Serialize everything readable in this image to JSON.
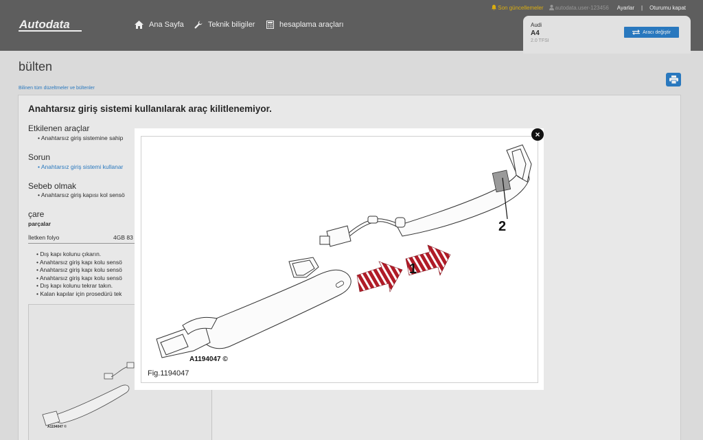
{
  "header": {
    "logo": "Autodata",
    "nav": [
      {
        "label": "Ana Sayfa",
        "icon": "home-icon"
      },
      {
        "label": "Teknik biligiler",
        "icon": "wrench-icon"
      },
      {
        "label": "hesaplama araçları",
        "icon": "calculator-icon"
      }
    ],
    "util": {
      "recent": "Son güncellemeler",
      "user": "autodata.user-123456",
      "settings": "Ayarlar",
      "separator": "|",
      "logout": "Oturumu kapat"
    },
    "vehicle": {
      "make": "Audi",
      "model": "A4",
      "engine": "2.0 TFSI",
      "change_button": "Aracı değiştir"
    }
  },
  "page": {
    "title": "bülten",
    "breadcrumb": "Bilinen tüm düzeltmeler ve bültenler"
  },
  "bulletin": {
    "title": "Anahtarsız giriş sistemi kullanılarak araç kilitlenemiyor.",
    "affected_heading": "Etkilenen araçlar",
    "affected_item": "• Anahtarsız giriş sistemine sahip",
    "problem_heading": "Sorun",
    "problem_item": "• Anahtarsız giriş sistemi kullanar",
    "cause_heading": "Sebeb olmak",
    "cause_item": "• Anahtarsız giriş kapısı kol sensö",
    "remedy_heading": "çare",
    "parts_heading": "parçalar",
    "parts": [
      {
        "name": "İletken folyo",
        "number": "4GB 83"
      }
    ],
    "steps": [
      "Dış kapı kolunu çıkarın.",
      "Anahtarsız giriş kapı kolu sensö",
      "Anahtarsız giriş kapı kolu sensö",
      "Anahtarsız giriş kapı kolu sensö",
      "Dış kapı kolunu tekrar takın.",
      "Kalan kapılar için prosedürü tek"
    ],
    "thumb_code": "A1194047 ©"
  },
  "modal": {
    "image_code": "A1194047 ©",
    "caption": "Fig.1194047",
    "callouts": [
      "1",
      "2"
    ],
    "close": "×"
  },
  "colors": {
    "header_bg": "#5b5b5b",
    "accent": "#1e78c8",
    "recent": "#e8b400",
    "arrow_red": "#b01c28"
  }
}
